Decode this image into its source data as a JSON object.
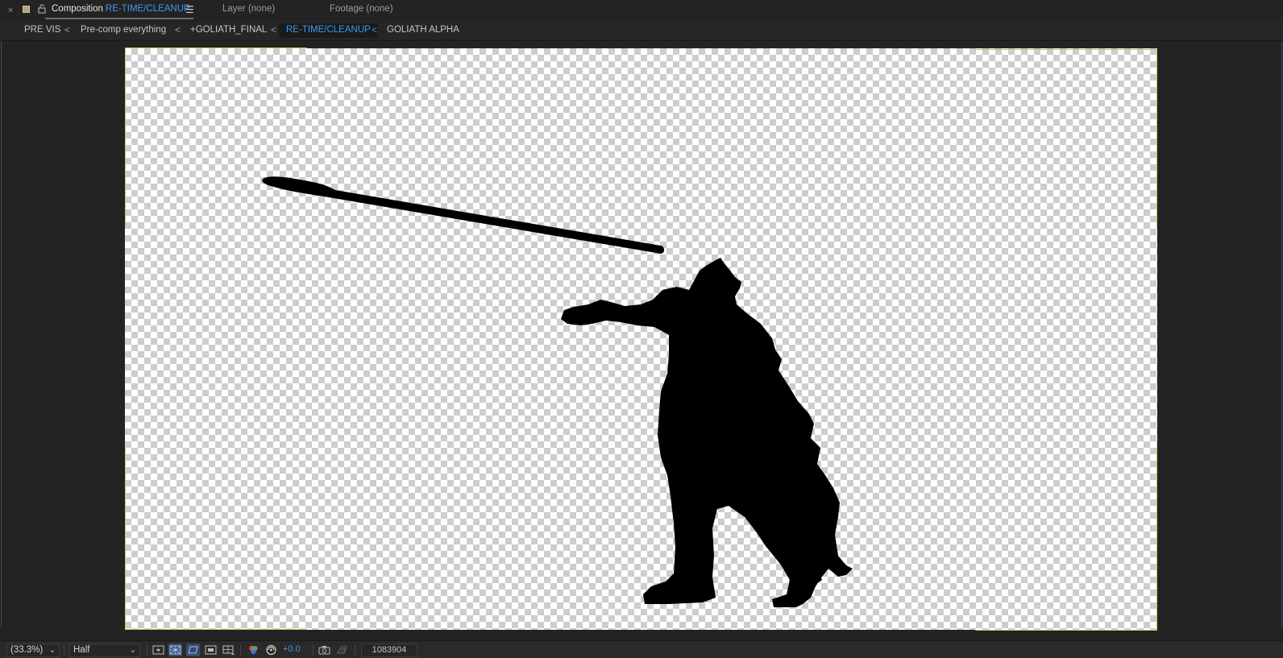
{
  "panel_tabs": {
    "close_glyph": "×",
    "composition_label": "Composition",
    "composition_name": "RE-TIME/CLEANUP",
    "menu_glyph": "☰",
    "layer_label": "Layer (none)",
    "footage_label": "Footage (none)"
  },
  "comp_navigator": {
    "crumbs": [
      "PRE VIS",
      "Pre-comp everything",
      "+GOLIATH_FINAL",
      "RE-TIME/CLEANUP",
      "GOLIATH ALPHA"
    ],
    "active_index": 3,
    "chevron": "<"
  },
  "viewer": {
    "background": "transparency-grid",
    "frame_color": "#d6c25b",
    "content": "black silhouette of figure throwing a spear"
  },
  "bottom_bar": {
    "magnification": "(33.3%)",
    "resolution": "Half",
    "exposure": "+0.0",
    "timecode": "1083904",
    "caret": "⌄"
  },
  "colors": {
    "accent": "#3d9bf0",
    "panel_bg": "#232323",
    "text": "#c6c6c6"
  }
}
